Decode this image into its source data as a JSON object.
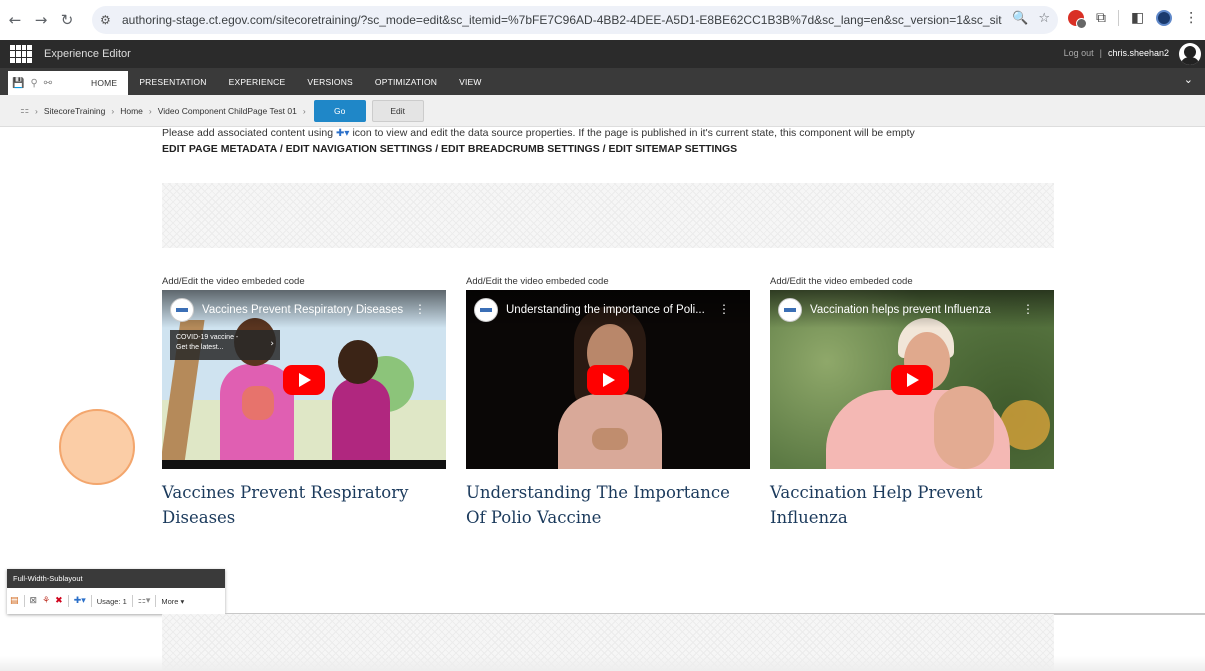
{
  "browser": {
    "url": "authoring-stage.ct.egov.com/sitecoretraining/?sc_mode=edit&sc_itemid=%7bFE7C96AD-4BB2-4DEE-A5D1-E8BE62CC1B3B%7d&sc_lang=en&sc_version=1&sc_site=SitecoreTraining"
  },
  "editor": {
    "title": "Experience Editor",
    "logout": "Log out",
    "separator": "|",
    "user": "chris.sheehan2"
  },
  "ribbon": {
    "tabs": [
      "HOME",
      "PRESENTATION",
      "EXPERIENCE",
      "VERSIONS",
      "OPTIMIZATION",
      "VIEW"
    ]
  },
  "breadcrumb": {
    "items": [
      "SitecoreTraining",
      "Home",
      "Video Component ChildPage Test 01"
    ],
    "go_label": "Go",
    "edit_label": "Edit"
  },
  "content": {
    "notice_before": "Please add associated content using",
    "notice_after": "icon to view and edit the data source properties. If the page is published in it's current state, this component will be empty",
    "meta_links": "EDIT PAGE METADATA / EDIT NAVIGATION SETTINGS / EDIT BREADCRUMB SETTINGS / EDIT SITEMAP SETTINGS"
  },
  "videos": [
    {
      "label": "Add/Edit the video embeded code",
      "video_title": "Vaccines Prevent Respiratory Diseases",
      "tooltip_line1": "COVID-19 vaccine -",
      "tooltip_line2": "Get the latest...",
      "caption": "Vaccines Prevent Respiratory Diseases"
    },
    {
      "label": "Add/Edit the video embeded code",
      "video_title": "Understanding the importance of Poli...",
      "caption": "Understanding The Importance Of Polio Vaccine"
    },
    {
      "label": "Add/Edit the video embeded code",
      "video_title": "Vaccination helps prevent Influenza",
      "caption": "Vaccination Help Prevent Influenza"
    }
  ],
  "sublayout": {
    "name": "Full-Width-Sublayout",
    "usage": "Usage: 1",
    "more": "More"
  }
}
